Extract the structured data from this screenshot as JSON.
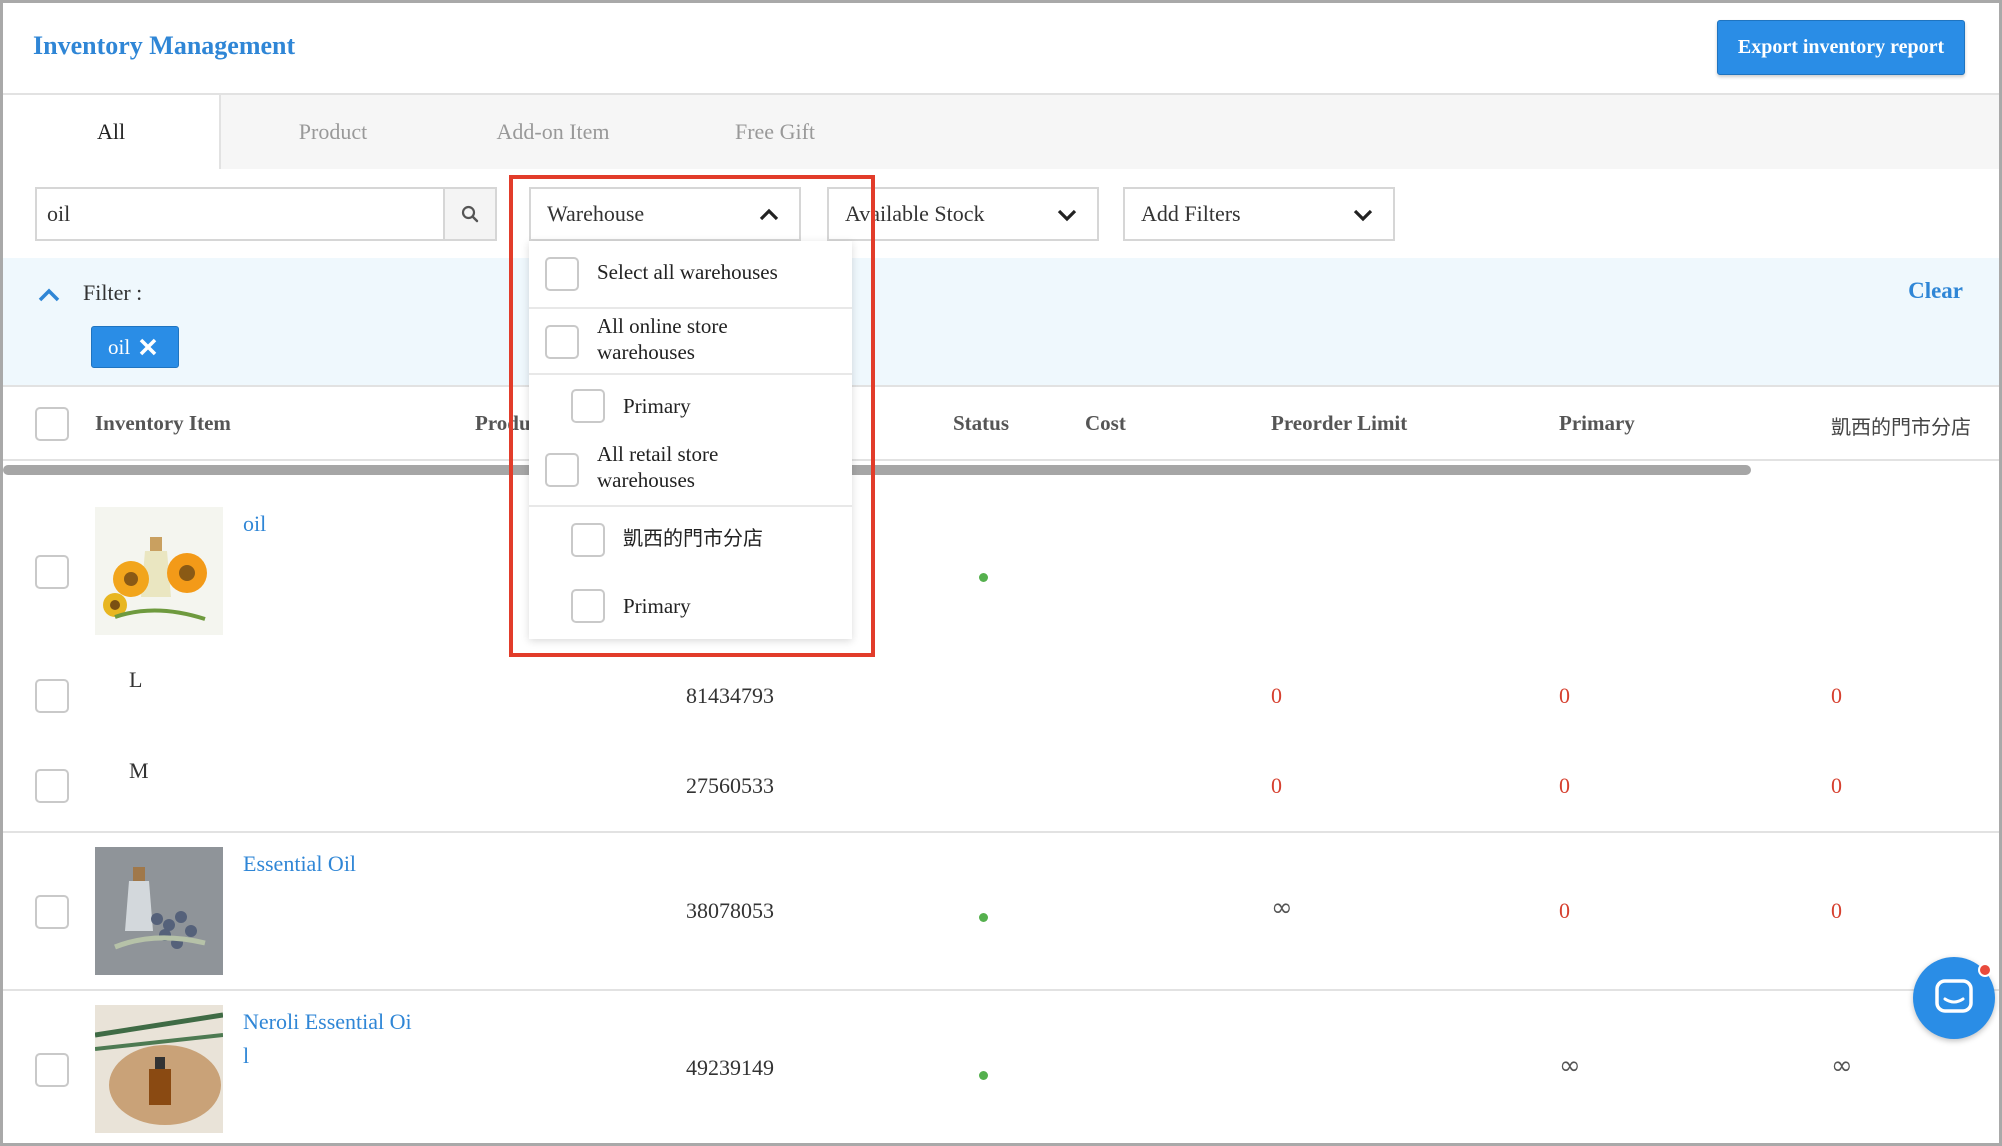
{
  "header": {
    "title": "Inventory Management",
    "export_label": "Export inventory report"
  },
  "tabs": [
    {
      "label": "All",
      "active": true
    },
    {
      "label": "Product",
      "active": false
    },
    {
      "label": "Add-on Item",
      "active": false
    },
    {
      "label": "Free Gift",
      "active": false
    }
  ],
  "search": {
    "value": "oil",
    "icon": "search-icon"
  },
  "filters_dropdowns": {
    "warehouse": "Warehouse",
    "available_stock": "Available Stock",
    "add_filters": "Add Filters"
  },
  "filter_bar": {
    "label": "Filter :",
    "chip": "oil",
    "clear": "Clear"
  },
  "table": {
    "headers": {
      "item": "Inventory Item",
      "product": "Produ",
      "status": "Status",
      "cost": "Cost",
      "preorder": "Preorder Limit",
      "primary": "Primary",
      "branch": "凱西的門市分店"
    },
    "rows": [
      {
        "name": "oil",
        "sku": "",
        "status_color": "#55b04e",
        "preorder": "",
        "primary": "",
        "branch": ""
      },
      {
        "name": "L",
        "sku": "81434793",
        "preorder": "0",
        "primary": "0",
        "branch": "0"
      },
      {
        "name": "M",
        "sku": "27560533",
        "preorder": "0",
        "primary": "0",
        "branch": "0"
      },
      {
        "name": "Essential Oil",
        "sku": "38078053",
        "status_color": "#55b04e",
        "preorder": "∞",
        "primary": "0",
        "branch": "0"
      },
      {
        "name_line1": "Neroli Essential Oi",
        "name_line2": "l",
        "sku": "49239149",
        "status_color": "#55b04e",
        "preorder": "",
        "primary": "∞",
        "branch": "∞"
      }
    ]
  },
  "warehouse_popup": {
    "select_all": "Select all warehouses",
    "online_line1": "All online store",
    "online_line2": "warehouses",
    "online_primary": "Primary",
    "retail_line1": "All retail store",
    "retail_line2": "warehouses",
    "retail_branch": "凱西的門市分店",
    "retail_primary": "Primary"
  },
  "colors": {
    "accent": "#2a8de6",
    "link": "#2f86d6",
    "zero": "#d6402f",
    "highlight": "#e23c2a"
  }
}
